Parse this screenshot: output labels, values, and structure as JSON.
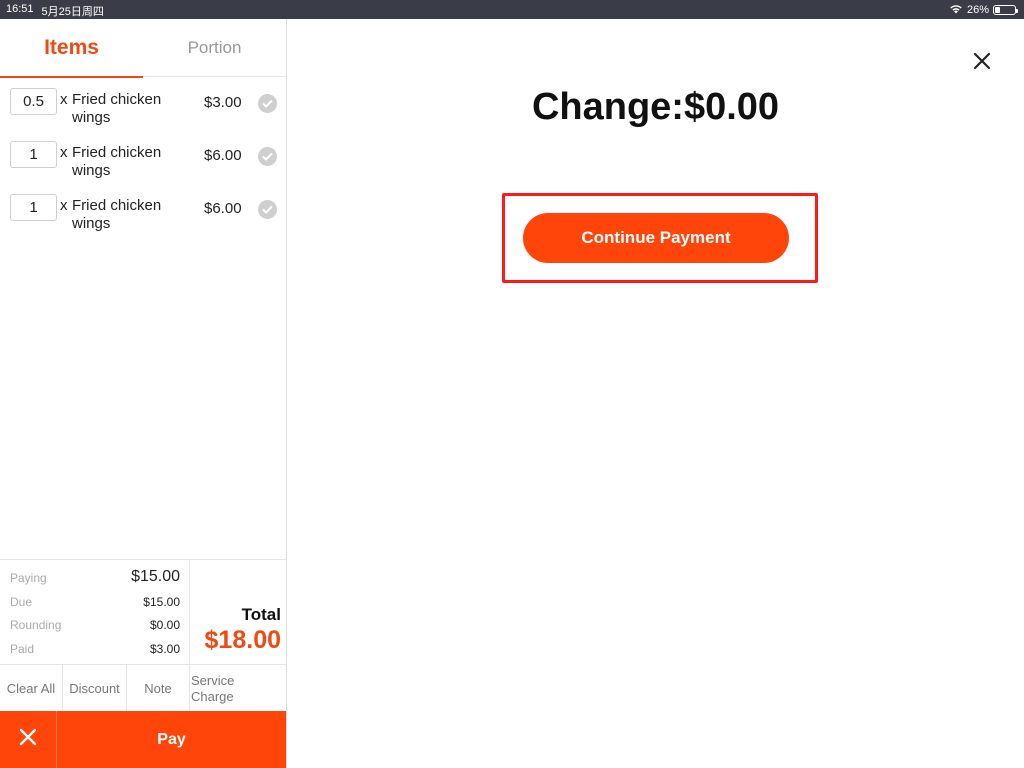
{
  "status_bar": {
    "time": "16:51",
    "date": "5月25日周四",
    "battery": "26%",
    "battery_level": 0.26
  },
  "tabs": [
    {
      "label": "Items",
      "active": true
    },
    {
      "label": "Portion",
      "active": false
    }
  ],
  "order_items": [
    {
      "qty": "0.5",
      "x": "x",
      "name_line1": "Fried chicken",
      "name_line2": "wings",
      "price": "$3.00"
    },
    {
      "qty": "1",
      "x": "x",
      "name_line1": "Fried chicken",
      "name_line2": "wings",
      "price": "$6.00"
    },
    {
      "qty": "1",
      "x": "x",
      "name_line1": "Fried chicken",
      "name_line2": "wings",
      "price": "$6.00"
    }
  ],
  "summary": {
    "paying_label": "Paying",
    "paying_value": "$15.00",
    "due_label": "Due",
    "due_value": "$15.00",
    "rounding_label": "Rounding",
    "rounding_value": "$0.00",
    "paid_label": "Paid",
    "paid_value": "$3.00",
    "total_label": "Total",
    "total_value": "$18.00"
  },
  "actions": {
    "clear_all": "Clear All",
    "discount": "Discount",
    "note": "Note",
    "service_charge_line1": "Service",
    "service_charge_line2": "Charge"
  },
  "bottom": {
    "pay_label": "Pay"
  },
  "right": {
    "change_text": "Change:$0.00",
    "continue_label": "Continue Payment"
  },
  "colors": {
    "accent": "#ff4509",
    "tab_active": "#f04a12",
    "highlight": "#ff1a1a"
  }
}
